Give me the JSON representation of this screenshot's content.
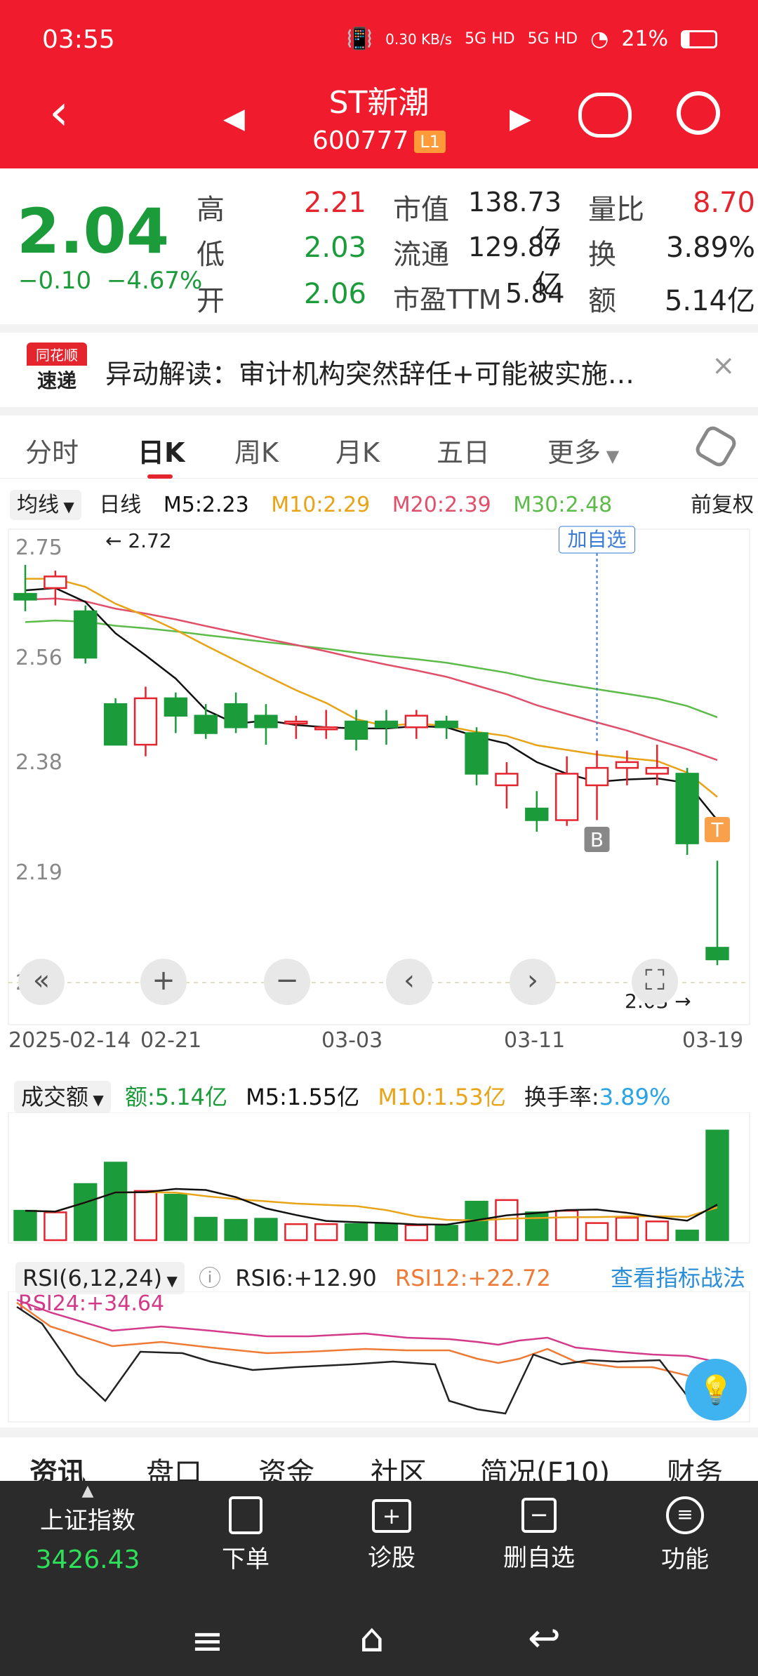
{
  "status": {
    "time": "03:55",
    "net_speed": "0.30 KB/s",
    "signal1": "5G HD",
    "signal2": "5G HD",
    "battery": "21%"
  },
  "header": {
    "title": "ST新潮",
    "code": "600777",
    "level": "L1"
  },
  "quote": {
    "price": "2.04",
    "change": "−0.10",
    "change_pct": "−4.67%",
    "high_label": "高",
    "high": "2.21",
    "low_label": "低",
    "low": "2.03",
    "open_label": "开",
    "open": "2.06",
    "mktcap_label": "市值",
    "mktcap": "138.73亿",
    "float_label": "流通",
    "float": "129.87亿",
    "pe_label": "市盈TTM",
    "pe": "5.84",
    "volratio_label": "量比",
    "volratio": "8.70",
    "turnover_label": "换",
    "turnover": "3.89%",
    "amount_label": "额",
    "amount": "5.14亿"
  },
  "news": {
    "logo_top": "同花顺",
    "logo_bottom": "速递",
    "text": "异动解读：审计机构突然辞任+可能被实施…"
  },
  "tabs": [
    "分时",
    "日K",
    "周K",
    "月K",
    "五日",
    "更多"
  ],
  "ma_bar": {
    "mode": "均线",
    "period": "日线",
    "m5": "M5:2.23",
    "m10": "M10:2.29",
    "m20": "M20:2.39",
    "m30": "M30:2.48",
    "adjust": "前复权"
  },
  "kline": {
    "y_ticks": [
      "2.75",
      "2.56",
      "2.38",
      "2.19",
      "2.00"
    ],
    "x_ticks": [
      "2025-02-14",
      "02-21",
      "03-03",
      "03-11",
      "03-19"
    ],
    "high_marker": "2.72",
    "low_marker": "2.03",
    "add_watch": "加自选",
    "b_marker": "B",
    "t_marker": "T"
  },
  "volume": {
    "title": "成交额",
    "amount": "额:5.14亿",
    "m5": "M5:1.55亿",
    "m10": "M10:1.53亿",
    "turnover_label": "换手率:",
    "turnover": "3.89%"
  },
  "rsi": {
    "title": "RSI(6,12,24)",
    "rsi6": "RSI6:+12.90",
    "rsi12": "RSI12:+22.72",
    "rsi24": "RSI24:+34.64",
    "strategy_link": "查看指标战法"
  },
  "bottom_tabs": [
    "资讯",
    "盘口",
    "资金",
    "社区",
    "简况(F10)",
    "财务"
  ],
  "nav": {
    "index_name": "上证指数",
    "index_value": "3426.43",
    "items": [
      {
        "label": "下单"
      },
      {
        "label": "诊股"
      },
      {
        "label": "删自选"
      },
      {
        "label": "功能"
      }
    ]
  },
  "colors": {
    "up": "#e5252e",
    "down": "#1b9b3a",
    "header": "#f01c2d",
    "m5": "#111111",
    "m10": "#e8a317",
    "m20": "#e0506b",
    "m30": "#5dbb4a"
  },
  "chart_data": {
    "type": "candlestick",
    "x": [
      "02-14",
      "02-17",
      "02-18",
      "02-19",
      "02-20",
      "02-21",
      "02-24",
      "02-25",
      "02-26",
      "02-27",
      "02-28",
      "03-03",
      "03-04",
      "03-05",
      "03-06",
      "03-07",
      "03-10",
      "03-11",
      "03-12",
      "03-13",
      "03-14",
      "03-17",
      "03-18",
      "03-19"
    ],
    "open": [
      2.67,
      2.68,
      2.64,
      2.48,
      2.41,
      2.49,
      2.46,
      2.48,
      2.46,
      2.45,
      2.44,
      2.45,
      2.45,
      2.44,
      2.45,
      2.43,
      2.34,
      2.3,
      2.28,
      2.34,
      2.37,
      2.36,
      2.36,
      2.06
    ],
    "close": [
      2.66,
      2.7,
      2.56,
      2.41,
      2.49,
      2.46,
      2.43,
      2.44,
      2.44,
      2.45,
      2.44,
      2.42,
      2.44,
      2.46,
      2.44,
      2.36,
      2.36,
      2.28,
      2.36,
      2.37,
      2.38,
      2.37,
      2.24,
      2.04
    ],
    "high": [
      2.72,
      2.71,
      2.65,
      2.49,
      2.51,
      2.5,
      2.48,
      2.5,
      2.48,
      2.46,
      2.47,
      2.47,
      2.47,
      2.47,
      2.46,
      2.44,
      2.38,
      2.33,
      2.39,
      2.4,
      2.4,
      2.41,
      2.37,
      2.21
    ],
    "low": [
      2.64,
      2.65,
      2.55,
      2.41,
      2.39,
      2.43,
      2.42,
      2.43,
      2.41,
      2.42,
      2.42,
      2.4,
      2.41,
      2.42,
      2.42,
      2.34,
      2.3,
      2.26,
      2.27,
      2.28,
      2.34,
      2.34,
      2.22,
      2.03
    ],
    "volume": [
      0.55,
      0.52,
      1.05,
      1.45,
      0.92,
      0.85,
      0.42,
      0.38,
      0.4,
      0.3,
      0.3,
      0.3,
      0.3,
      0.28,
      0.27,
      0.72,
      0.75,
      0.52,
      0.55,
      0.32,
      0.42,
      0.35,
      0.18,
      2.05
    ],
    "ylim": [
      2.0,
      2.75
    ]
  }
}
